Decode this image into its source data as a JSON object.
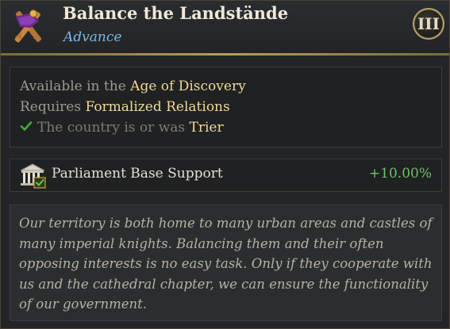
{
  "header": {
    "title": "Balance the Landstände",
    "subtitle": "Advance",
    "icon": "crossed-scrolls-icon",
    "tier": "III"
  },
  "requirements": {
    "available_prefix": "Available in the",
    "available_value": "Age of Discovery",
    "requires_prefix": "Requires",
    "requires_value": "Formalized Relations",
    "country_prefix": "The country is or was",
    "country_value": "Trier",
    "country_met": true
  },
  "modifier": {
    "icon": "parliament-building-icon",
    "label": "Parliament Base Support",
    "value": "+10.00%"
  },
  "flavor": {
    "line1": "Our territory is both home to many urban areas and castles of",
    "line2": "many imperial knights. Balancing them and their often",
    "line3": "opposing interests is no easy task. Only if they cooperate with",
    "line4": "us and the cathedral chapter, we can ensure the functionality",
    "line5": "of our government."
  },
  "colors": {
    "title": "#efe8d8",
    "subtitle": "#7ab8e6",
    "highlight": "#f1da94",
    "positive": "#69c466",
    "check": "#3fae3a"
  }
}
